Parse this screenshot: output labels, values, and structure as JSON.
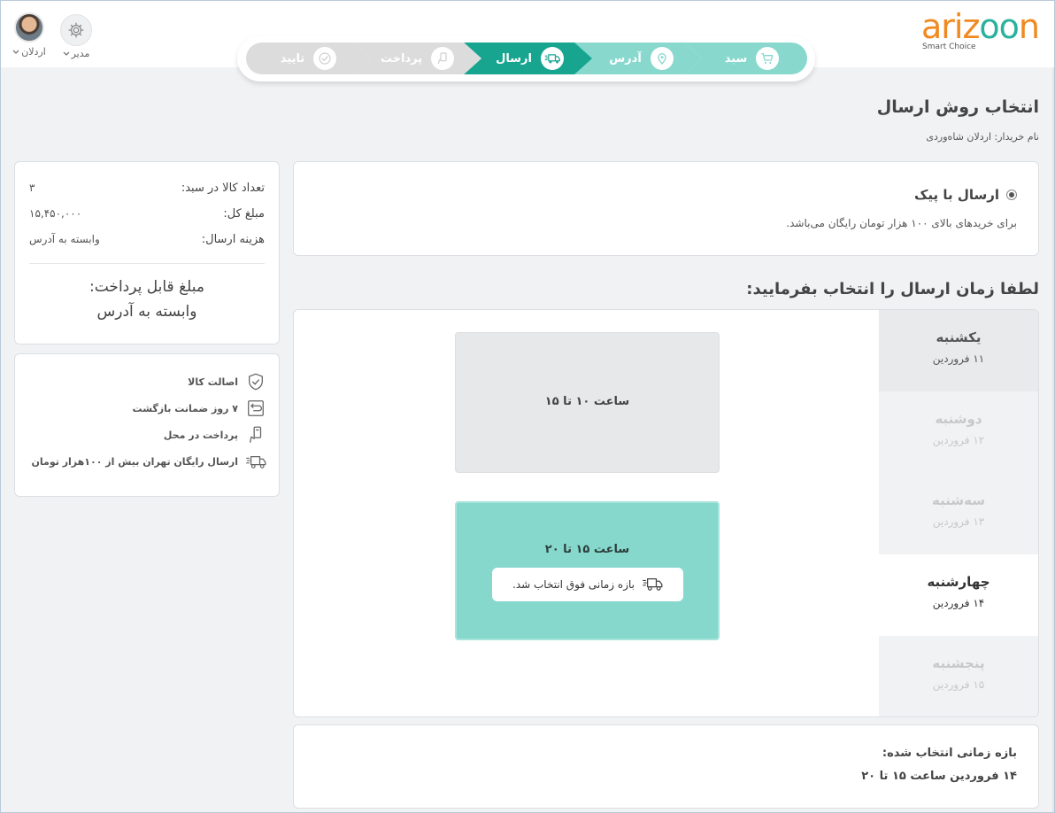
{
  "logo": {
    "text_orange": "ariz",
    "text_teal": "oo",
    "text_end": "n",
    "subtitle": "Smart Choice"
  },
  "user": {
    "name": "اردلان",
    "role": "مدیر"
  },
  "steps": [
    {
      "label": "سبد",
      "state": "done",
      "icon": "cart-icon"
    },
    {
      "label": "آدرس",
      "state": "done",
      "icon": "map-pin-icon"
    },
    {
      "label": "ارسال",
      "state": "active",
      "icon": "truck-icon"
    },
    {
      "label": "پرداخت",
      "state": "pending",
      "icon": "hand-card-icon"
    },
    {
      "label": "تایید",
      "state": "pending",
      "icon": "check-badge-icon"
    }
  ],
  "page": {
    "title": "انتخاب روش ارسال",
    "buyer_line": "نام خریدار: اردلان شاه‌وردی"
  },
  "method": {
    "title": "ارسال با پیک",
    "description": "برای خریدهای بالای ۱۰۰ هزار تومان رایگان می‌باشد.",
    "selected": true
  },
  "schedule": {
    "title": "لطفا زمان ارسال را انتخاب بفرمایید:",
    "days": [
      {
        "name": "یکشنبه",
        "date": "۱۱ فروردین",
        "state": "available"
      },
      {
        "name": "دوشنبه",
        "date": "۱۲ فروردین",
        "state": "disabled"
      },
      {
        "name": "سه‌شنبه",
        "date": "۱۳ فروردین",
        "state": "disabled"
      },
      {
        "name": "چهارشنبه",
        "date": "۱۴ فروردین",
        "state": "active"
      },
      {
        "name": "پنجشنبه",
        "date": "۱۵ فروردین",
        "state": "disabled"
      }
    ],
    "slots": [
      {
        "label": "ساعت ۱۰ تا ۱۵",
        "selected": false
      },
      {
        "label": "ساعت ۱۵ تا ۲۰",
        "selected": true,
        "badge": "بازه زمانی فوق انتخاب شد."
      }
    ]
  },
  "selected_range": {
    "label": "بازه زمانی انتخاب شده:",
    "value": "۱۴ فروردین ساعت ۱۵ تا ۲۰"
  },
  "summary": {
    "items_label": "تعداد کالا در سبد:",
    "items_value": "۳",
    "total_label": "مبلغ کل:",
    "total_value": "۱۵,۴۵۰,۰۰۰",
    "shipping_label": "هزینه ارسال:",
    "shipping_value": "وابسته به آدرس",
    "payable_label": "مبلغ قابل پرداخت:",
    "payable_value": "وابسته به آدرس"
  },
  "features": [
    {
      "label": "اصالت کالا",
      "icon": "shield-check-icon"
    },
    {
      "label": "۷ روز ضمانت بازگشت",
      "icon": "return-box-icon"
    },
    {
      "label": "پرداخت در محل",
      "icon": "hand-card-icon"
    },
    {
      "label": "ارسال رایگان تهران بیش از ۱۰۰هزار تومان",
      "icon": "truck-icon"
    }
  ],
  "colors": {
    "primary": "#17a590",
    "primary_light": "#88d8ce",
    "accent_orange": "#f08a20",
    "inactive": "#dcdcdc"
  }
}
